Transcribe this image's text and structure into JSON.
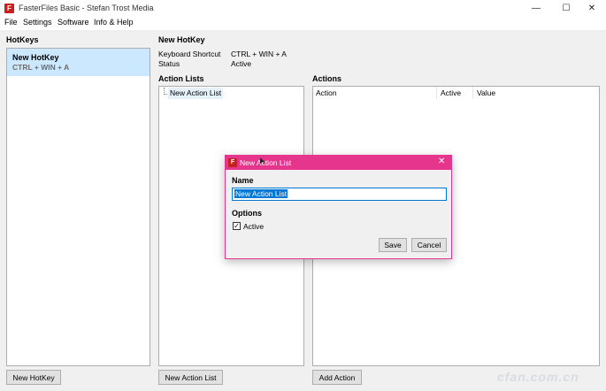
{
  "window": {
    "title": "FasterFiles Basic - Stefan Trost Media",
    "app_icon_letter": "F",
    "min_glyph": "—",
    "max_glyph": "☐",
    "close_glyph": "✕"
  },
  "menu": [
    "File",
    "Settings",
    "Software",
    "Info & Help"
  ],
  "hotkeys_panel": {
    "label": "HotKeys",
    "items": [
      {
        "name": "New HotKey",
        "shortcut": "CTRL + WIN + A"
      }
    ],
    "add_button": "New HotKey"
  },
  "details": {
    "title": "New HotKey",
    "shortcut_label": "Keyboard Shortcut",
    "shortcut_value": "CTRL + WIN + A",
    "status_label": "Status",
    "status_value": "Active"
  },
  "action_lists": {
    "label": "Action Lists",
    "items": [
      "New Action List"
    ],
    "add_button": "New Action List"
  },
  "actions": {
    "label": "Actions",
    "columns": [
      "Action",
      "Active",
      "Value"
    ],
    "add_button": "Add Action"
  },
  "dialog": {
    "title": "New Action List",
    "icon_letter": "F",
    "close_glyph": "✕",
    "name_label": "Name",
    "name_value": "New Action List",
    "options_label": "Options",
    "active_label": "Active",
    "active_checked": true,
    "check_glyph": "✓",
    "save_button": "Save",
    "cancel_button": "Cancel"
  },
  "cursor_glyph": "➤",
  "colors": {
    "dialog_accent": "#e6358c",
    "selection": "#cce8ff",
    "input_selection": "#0078d7"
  }
}
